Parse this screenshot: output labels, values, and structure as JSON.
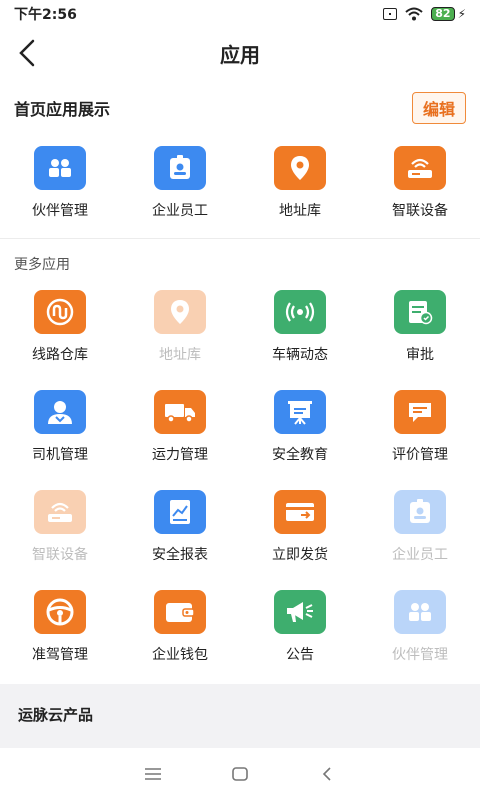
{
  "status": {
    "time": "下午2:56",
    "battery": "82"
  },
  "header": {
    "title": "应用"
  },
  "home_section": {
    "title": "首页应用展示",
    "edit_label": "编辑",
    "apps": [
      {
        "label": "伙伴管理",
        "icon": "partners-icon",
        "color": "blue"
      },
      {
        "label": "企业员工",
        "icon": "employee-badge-icon",
        "color": "blue"
      },
      {
        "label": "地址库",
        "icon": "location-pin-icon",
        "color": "orange"
      },
      {
        "label": "智联设备",
        "icon": "router-icon",
        "color": "orange"
      }
    ]
  },
  "more_section": {
    "title": "更多应用",
    "apps": [
      {
        "label": "线路仓库",
        "icon": "route-icon",
        "color": "orange",
        "disabled": false
      },
      {
        "label": "地址库",
        "icon": "location-pin-icon",
        "color": "orange",
        "disabled": true
      },
      {
        "label": "车辆动态",
        "icon": "signal-icon",
        "color": "green",
        "disabled": false
      },
      {
        "label": "审批",
        "icon": "approval-icon",
        "color": "green",
        "disabled": false
      },
      {
        "label": "司机管理",
        "icon": "driver-icon",
        "color": "blue",
        "disabled": false
      },
      {
        "label": "运力管理",
        "icon": "truck-icon",
        "color": "orange",
        "disabled": false
      },
      {
        "label": "安全教育",
        "icon": "presentation-icon",
        "color": "blue",
        "disabled": false
      },
      {
        "label": "评价管理",
        "icon": "comment-icon",
        "color": "orange",
        "disabled": false
      },
      {
        "label": "智联设备",
        "icon": "router-icon",
        "color": "orange",
        "disabled": true
      },
      {
        "label": "安全报表",
        "icon": "report-icon",
        "color": "blue",
        "disabled": false
      },
      {
        "label": "立即发货",
        "icon": "shipment-icon",
        "color": "orange",
        "disabled": false
      },
      {
        "label": "企业员工",
        "icon": "employee-badge-icon",
        "color": "blue",
        "disabled": true
      },
      {
        "label": "准驾管理",
        "icon": "steering-wheel-icon",
        "color": "orange",
        "disabled": false
      },
      {
        "label": "企业钱包",
        "icon": "wallet-icon",
        "color": "orange",
        "disabled": false
      },
      {
        "label": "公告",
        "icon": "megaphone-icon",
        "color": "green",
        "disabled": false
      },
      {
        "label": "伙伴管理",
        "icon": "partners-icon",
        "color": "blue",
        "disabled": true
      }
    ]
  },
  "product": {
    "title": "运脉云产品"
  },
  "colors": {
    "blue": "#3d8af0",
    "orange": "#f07a24",
    "green": "#3eae6e",
    "accent": "#e8701f"
  }
}
